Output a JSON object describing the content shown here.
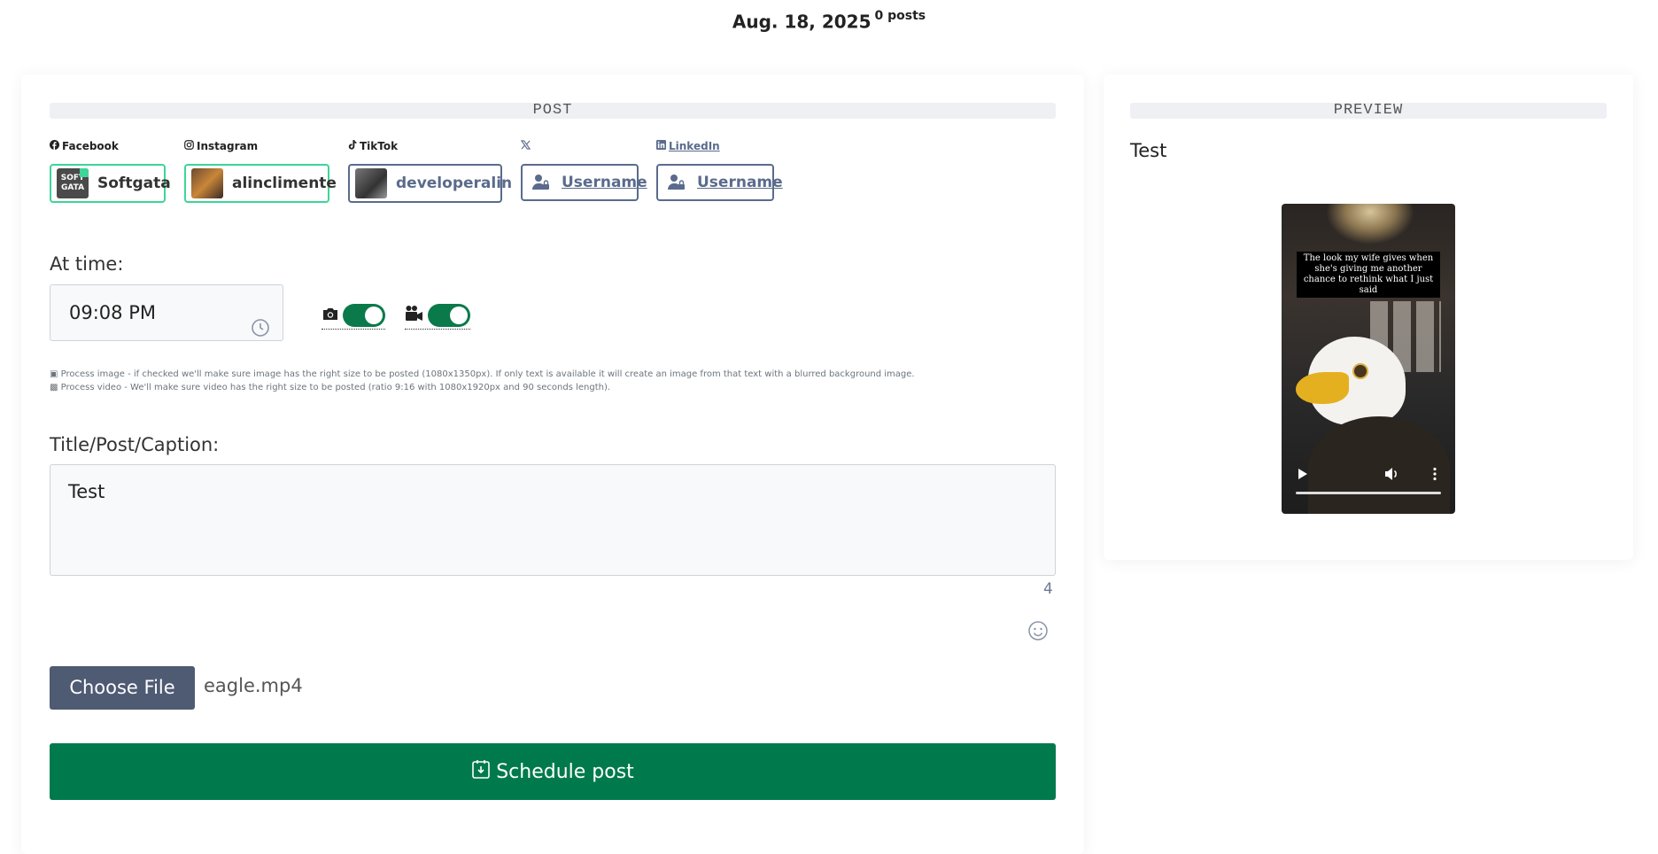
{
  "header": {
    "date": "Aug. 18, 2025",
    "posts_count": "0 posts"
  },
  "post_section": {
    "title": "POST"
  },
  "preview_section": {
    "title": "PREVIEW"
  },
  "platforms": [
    {
      "name": "Facebook",
      "icon": "facebook-icon",
      "account": "Softgata"
    },
    {
      "name": "Instagram",
      "icon": "instagram-icon",
      "account": "alinclimente"
    },
    {
      "name": "TikTok",
      "icon": "tiktok-icon",
      "account": "developeralin"
    },
    {
      "name": "",
      "icon": "x-icon",
      "account": "Username"
    },
    {
      "name": "LinkedIn",
      "icon": "linkedin-icon",
      "account": "Username"
    }
  ],
  "time": {
    "label": "At time:",
    "value": "09:08 PM"
  },
  "help": {
    "image": "Process image - if checked we'll make sure image has the right size to be posted (1080x1350px). If only text is available it will create an image from that text with a blurred background image.",
    "video": "Process video - We'll make sure video has the right size to be posted (ratio 9:16 with 1080x1920px and 90 seconds length)."
  },
  "toggles": {
    "process_image": true,
    "process_video": true
  },
  "caption": {
    "label": "Title/Post/Caption:",
    "value": "Test",
    "char_count": "4"
  },
  "file": {
    "button": "Choose File",
    "name": "eagle.mp4"
  },
  "schedule": {
    "label": "Schedule post"
  },
  "preview": {
    "text": "Test",
    "video_caption": "The look my wife gives when she's giving me another chance to rethink what I just said"
  },
  "colors": {
    "accent": "#007a4d",
    "selected_border": "#3dd598",
    "muted": "#5a6b8c"
  }
}
